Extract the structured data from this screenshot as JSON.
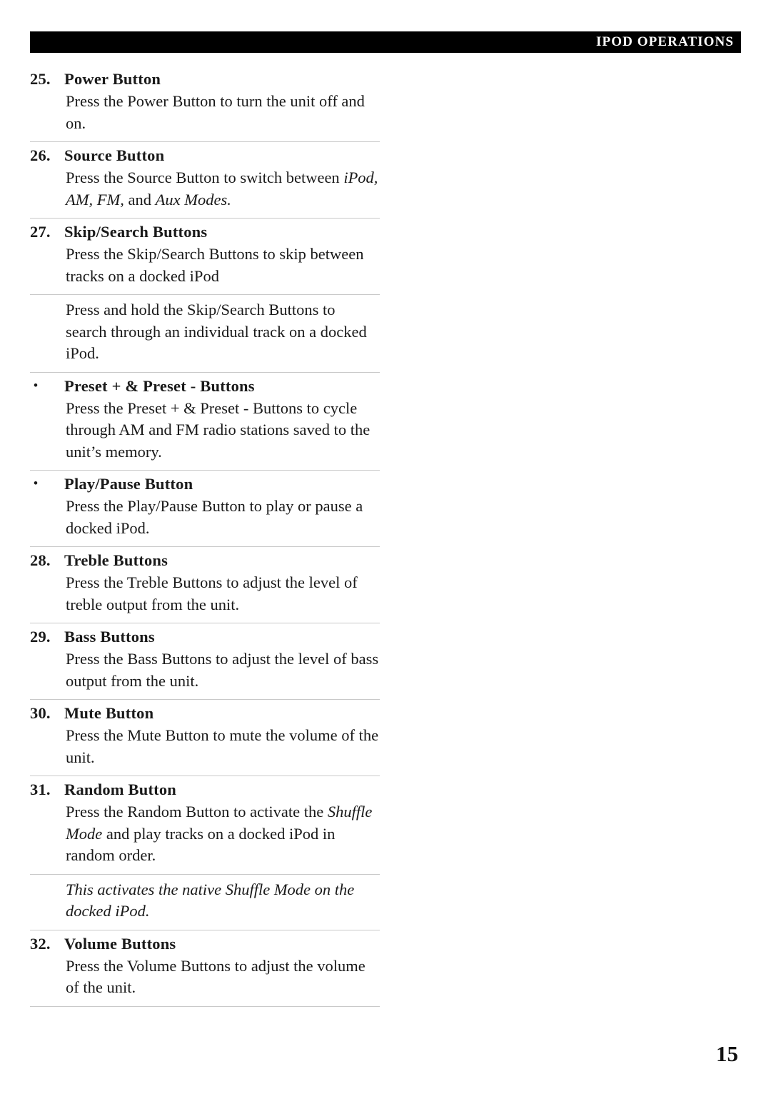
{
  "header": {
    "title": "IPOD OPERATIONS"
  },
  "page_number": "15",
  "entries": [
    {
      "marker": "25.",
      "title": "Power Button",
      "body_html": "Press the Power Button to turn the unit off and on."
    },
    {
      "marker": "26.",
      "title": "Source Button",
      "body_html": "Press the Source Button to switch between <i class=\"it\">iPod, AM, FM,</i> and <i class=\"it\">Aux Modes.</i>"
    },
    {
      "marker": "27.",
      "title": "Skip/Search Buttons",
      "body_html": "Press the Skip/Search Buttons to skip between tracks on a docked iPod"
    },
    {
      "marker": "",
      "title": "",
      "body_html": "Press and hold the Skip/Search Buttons to search through an individual track on a docked iPod."
    },
    {
      "marker": "•",
      "title": "Preset + & Preset - Buttons",
      "body_html": "Press the Preset + & Preset - Buttons to cycle through AM and FM radio stations saved to the unit’s memory."
    },
    {
      "marker": "•",
      "title": "Play/Pause Button",
      "body_html": "Press the Play/Pause Button to play or pause a docked iPod."
    },
    {
      "marker": "28.",
      "title": "Treble Buttons",
      "body_html": "Press the Treble Buttons to adjust the level of treble output from the unit."
    },
    {
      "marker": "29.",
      "title": "Bass Buttons",
      "body_html": "Press the Bass Buttons to adjust the level of bass output from the unit."
    },
    {
      "marker": "30.",
      "title": "Mute Button",
      "body_html": "Press the Mute Button to mute the volume of the unit."
    },
    {
      "marker": "31.",
      "title": "Random Button",
      "body_html": "Press the Random Button to activate the <i class=\"it\">Shuffle Mode</i> and play tracks on a docked iPod in random order."
    },
    {
      "marker": "",
      "title": "",
      "note_html": "This activates the native Shuffle Mode on the docked iPod."
    },
    {
      "marker": "32.",
      "title": "Volume Buttons",
      "body_html": "Press the Volume Buttons to adjust the volume of the unit."
    }
  ]
}
